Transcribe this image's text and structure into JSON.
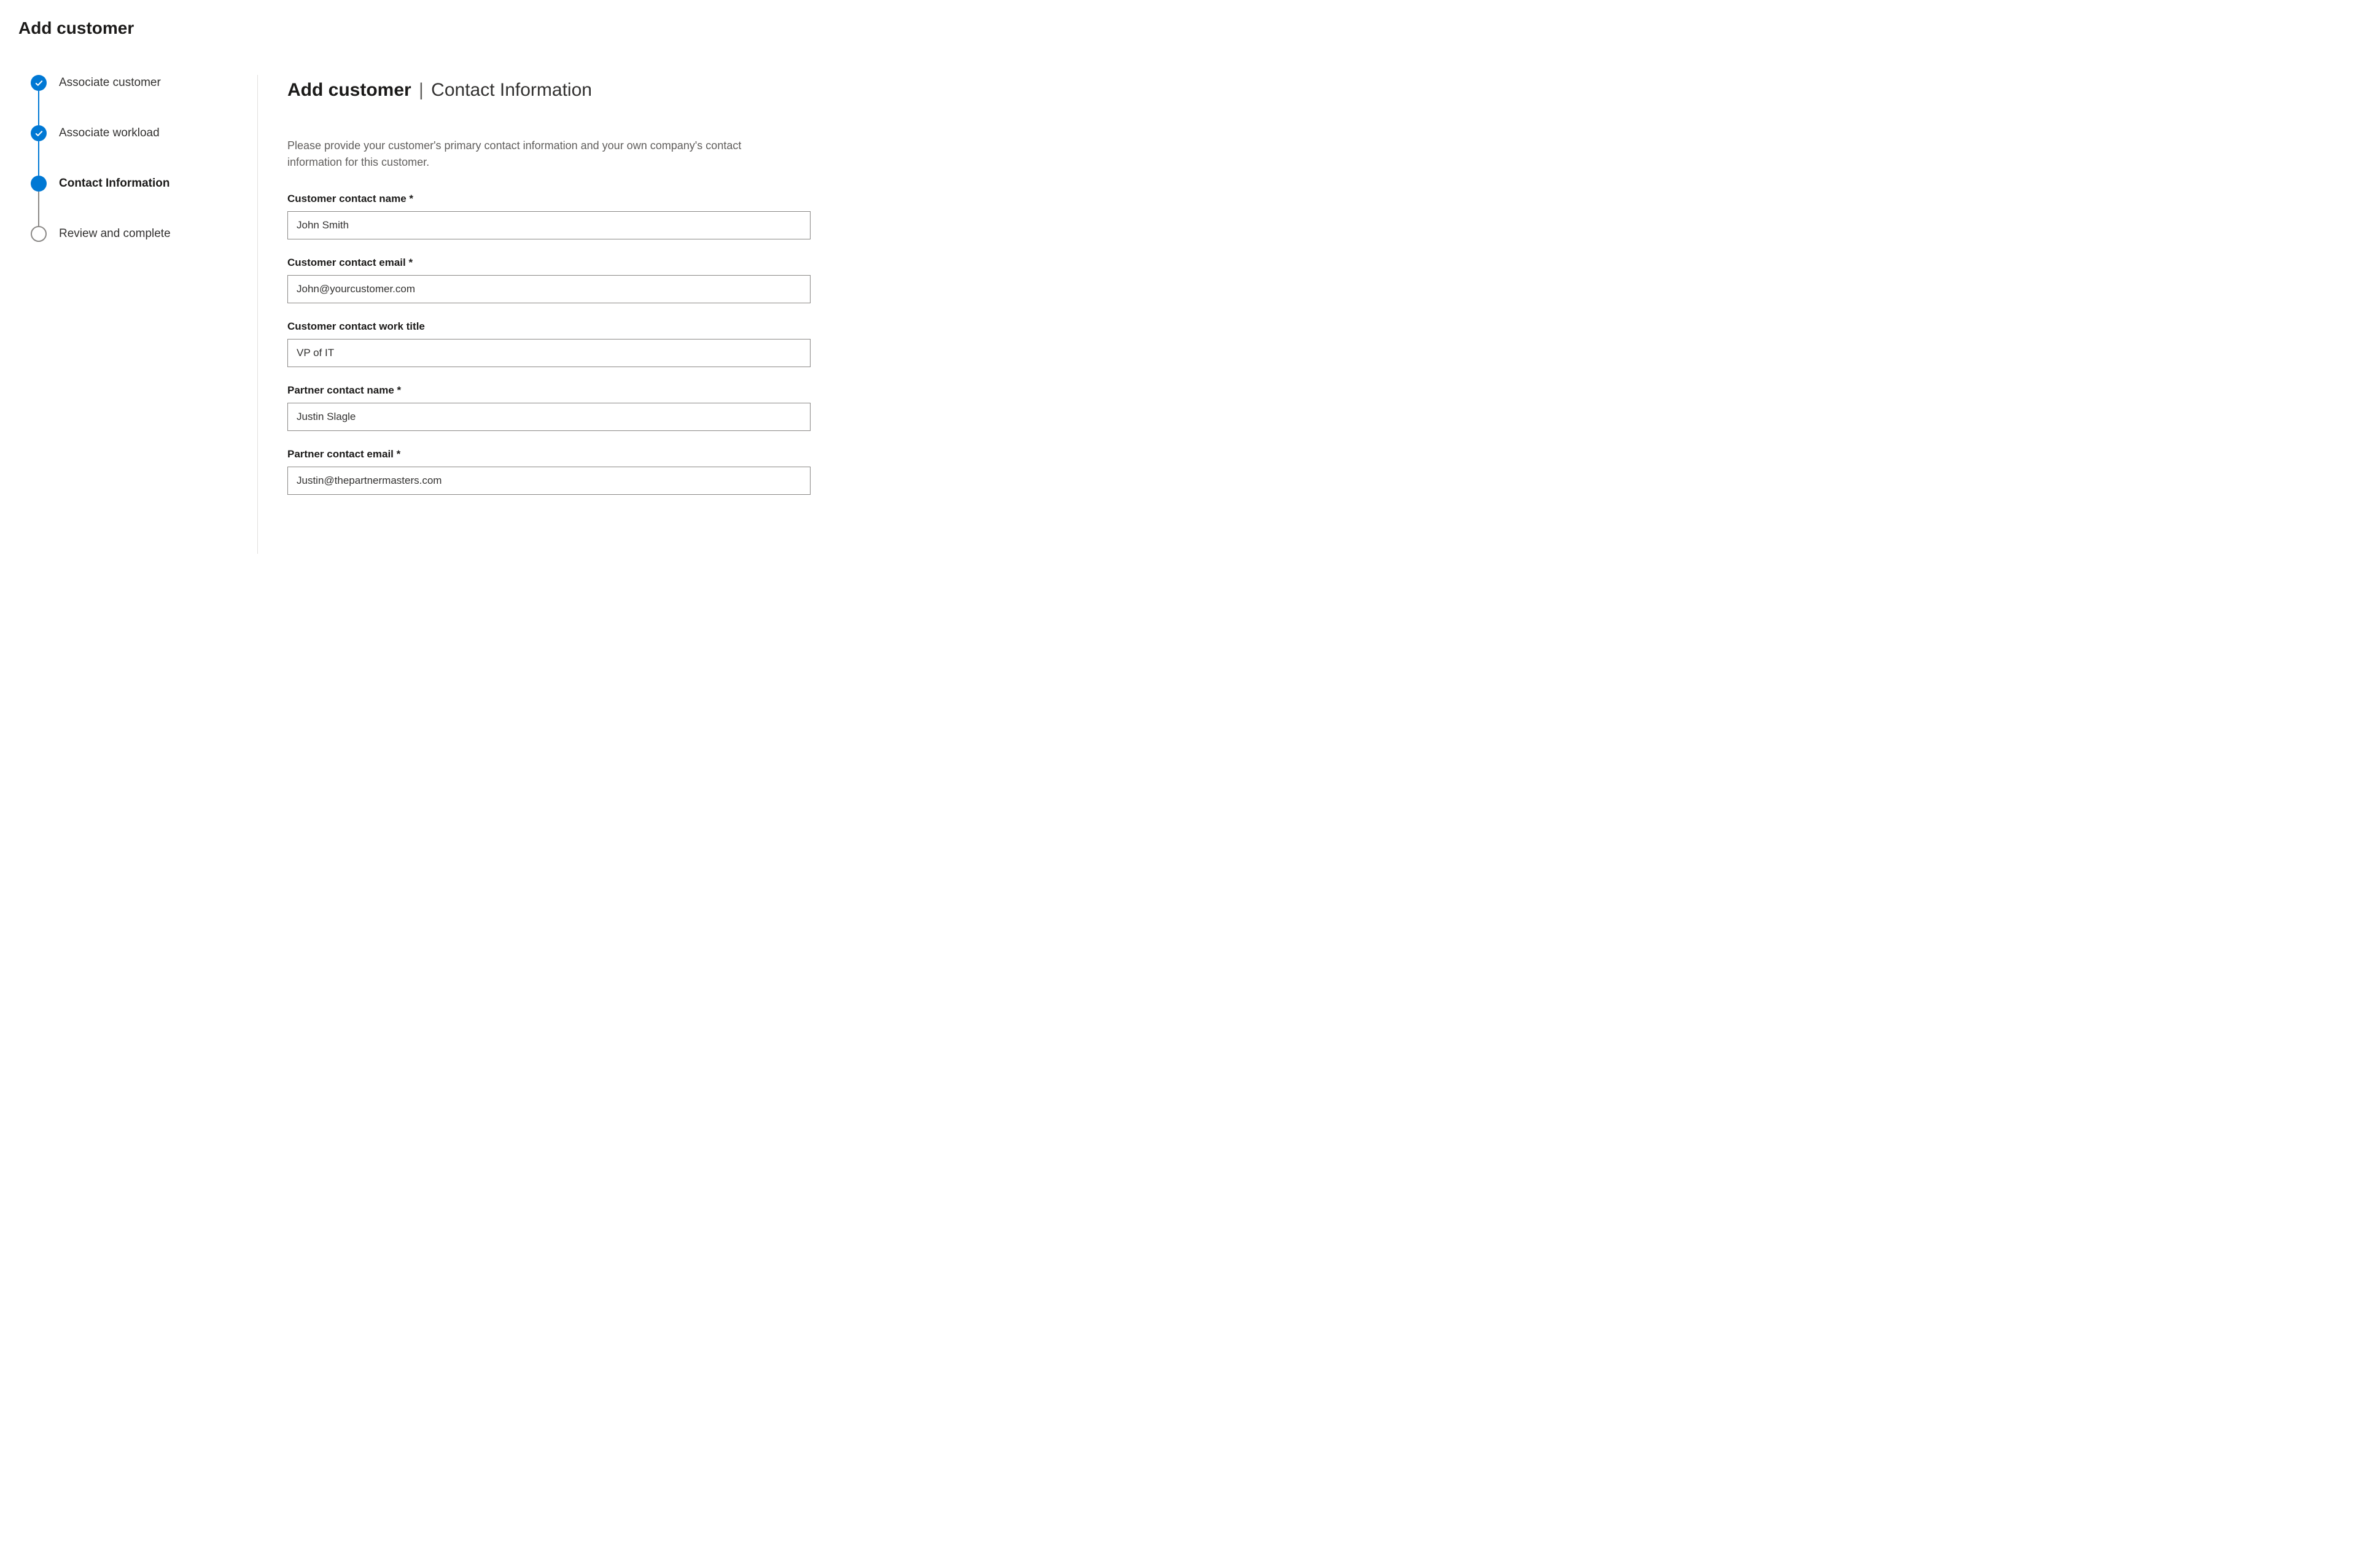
{
  "header": {
    "title": "Add customer"
  },
  "steps": [
    {
      "label": "Associate customer",
      "state": "done"
    },
    {
      "label": "Associate workload",
      "state": "done"
    },
    {
      "label": "Contact Information",
      "state": "current"
    },
    {
      "label": "Review and complete",
      "state": "upcoming"
    }
  ],
  "main": {
    "title_bold": "Add customer",
    "title_sep": " | ",
    "title_rest": "Contact Information",
    "description": "Please provide your customer's primary contact information and your own company's contact information for this customer."
  },
  "form": {
    "customer_contact_name": {
      "label": "Customer contact name *",
      "value": "John Smith"
    },
    "customer_contact_email": {
      "label": "Customer contact email *",
      "value": "John@yourcustomer.com"
    },
    "customer_contact_title": {
      "label": "Customer contact work title",
      "value": "VP of IT"
    },
    "partner_contact_name": {
      "label": "Partner contact name *",
      "value": "Justin Slagle"
    },
    "partner_contact_email": {
      "label": "Partner contact email *",
      "value": "Justin@thepartnermasters.com"
    }
  }
}
